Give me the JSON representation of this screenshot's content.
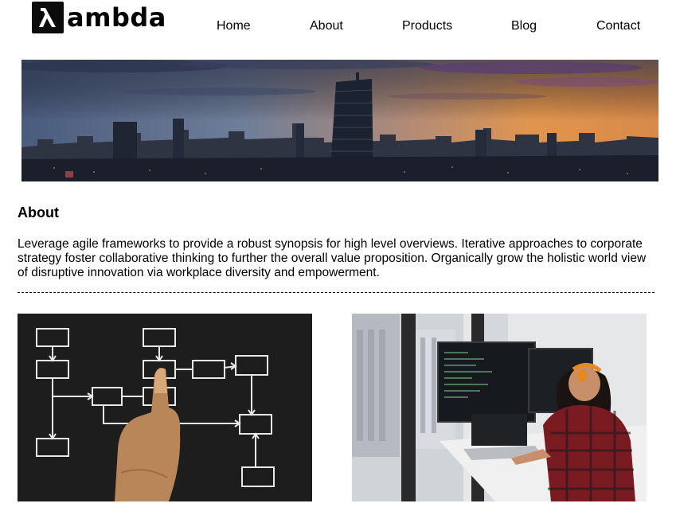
{
  "brand": {
    "icon": "lambda-icon",
    "name": "ambda"
  },
  "nav": {
    "items": [
      "Home",
      "About",
      "Products",
      "Blog",
      "Contact"
    ]
  },
  "hero": {
    "image": "city-skyline-sunset"
  },
  "about": {
    "title": "About",
    "body": "Leverage agile frameworks to provide a robust synopsis for high level overviews. Iterative approaches to corporate strategy foster collaborative thinking to further the overall value proposition. Organically grow the holistic world view of disruptive innovation via workplace diversity and empowerment."
  },
  "images": {
    "left": "flowchart-chalkboard-hand",
    "right": "developer-at-monitors"
  },
  "colors": {
    "text": "#000000",
    "logo_box": "#0b0b0b",
    "background": "#ffffff"
  }
}
